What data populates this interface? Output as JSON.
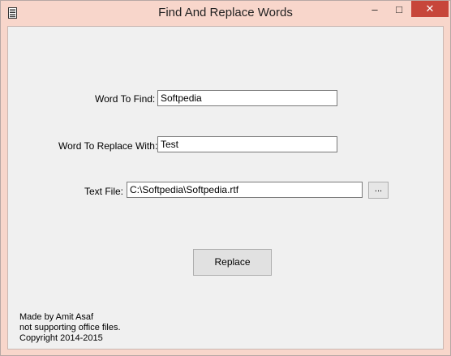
{
  "window": {
    "title": "Find And Replace Words"
  },
  "controls": {
    "minimize_glyph": "–",
    "maximize_glyph": "□",
    "close_glyph": "✕"
  },
  "form": {
    "find_label": "Word To Find:",
    "find_value": "Softpedia",
    "replace_label": "Word To Replace With:",
    "replace_value": "Test",
    "file_label": "Text File:",
    "file_value": "C:\\Softpedia\\Softpedia.rtf",
    "browse_label": "...",
    "replace_button": "Replace"
  },
  "footer": {
    "line1": "Made by Amit Asaf",
    "line2": "not supporting office files.",
    "line3": "Copyright 2014-2015"
  },
  "colors": {
    "frame": "#f8d6cb",
    "close": "#c7463a",
    "client": "#f0f0f0"
  }
}
